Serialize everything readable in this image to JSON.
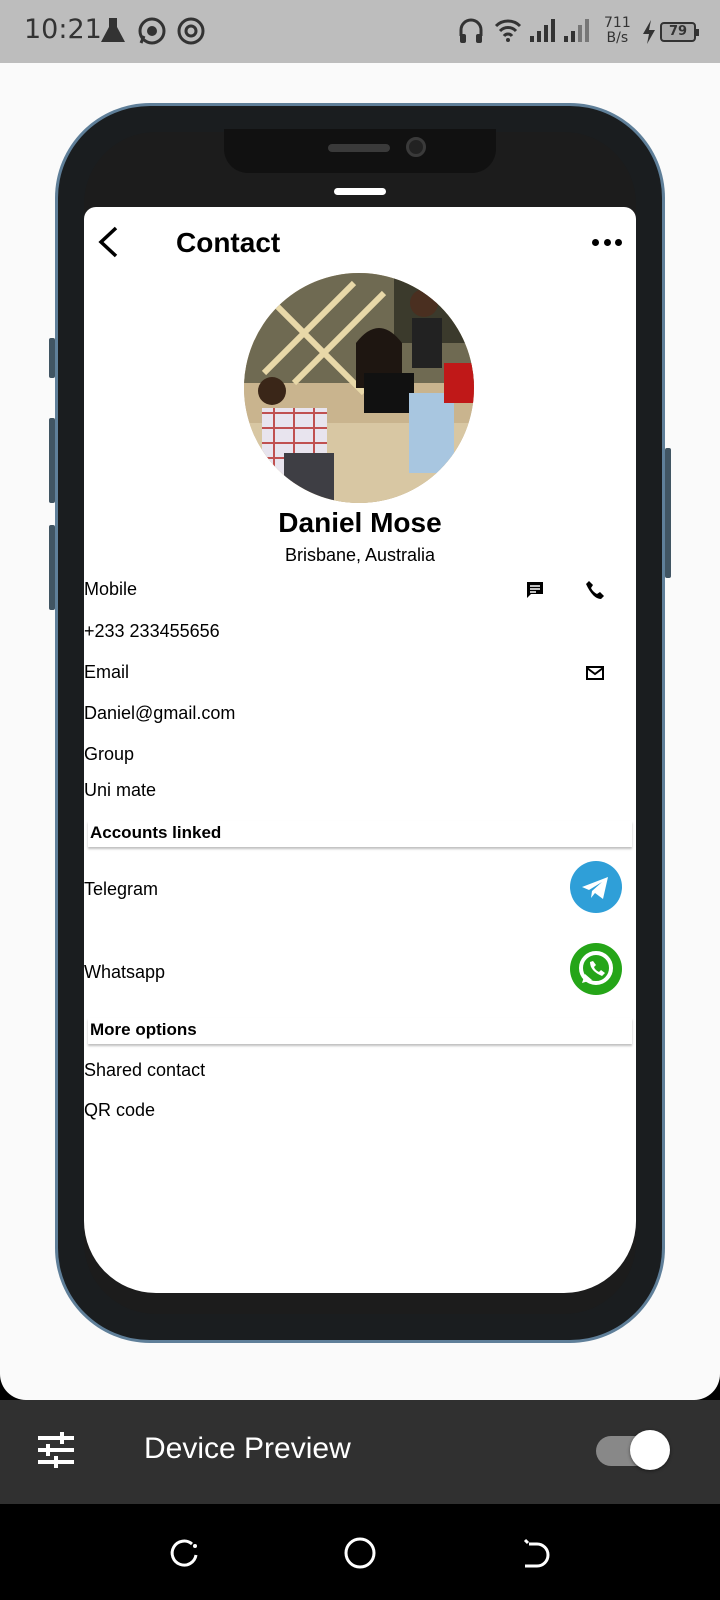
{
  "status_bar": {
    "time": "10:21",
    "net_speed_value": "711",
    "net_speed_unit": "B/s",
    "battery": "79"
  },
  "contact": {
    "screen_title": "Contact",
    "name": "Daniel Mose",
    "location": "Brisbane, Australia",
    "mobile_label": "Mobile",
    "mobile_value": "+233 233455656",
    "email_label": "Email",
    "email_value": "Daniel@gmail.com",
    "group_label": "Group",
    "group_value": "Uni mate"
  },
  "accounts": {
    "header": "Accounts linked",
    "items": [
      {
        "label": "Telegram",
        "icon": "telegram-icon",
        "color": "#2f9fd8"
      },
      {
        "label": "Whatsapp",
        "icon": "whatsapp-icon",
        "color": "#25a518"
      }
    ]
  },
  "more_options": {
    "header": "More options",
    "items": [
      {
        "label": "Shared contact"
      },
      {
        "label": "QR code"
      }
    ]
  },
  "preview_bar": {
    "title": "Device Preview",
    "toggle_on": true
  }
}
